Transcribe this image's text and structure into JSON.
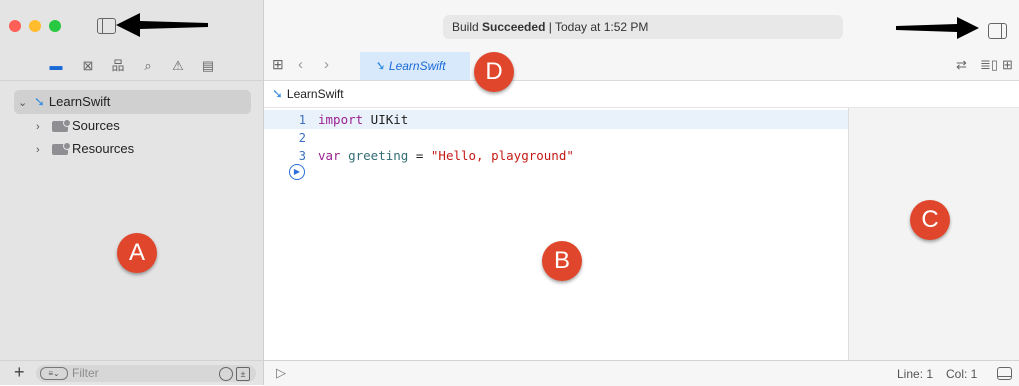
{
  "window": {
    "status_main": "Build",
    "status_bold": "Succeeded",
    "status_sep": "|",
    "status_time": "Today at 1:52 PM"
  },
  "navigator": {
    "tree": [
      {
        "label": "LearnSwift",
        "chevron": "⌄"
      },
      {
        "label": "Sources",
        "chevron": "›"
      },
      {
        "label": "Resources",
        "chevron": "›"
      }
    ],
    "filter_placeholder": "Filter",
    "add_symbol": "+"
  },
  "editor": {
    "tab_label": "LearnSwift",
    "breadcrumb": "LearnSwift",
    "lines": [
      {
        "num": "1",
        "kw": "import",
        "rest": " UIKit"
      },
      {
        "num": "2"
      },
      {
        "num": "3",
        "kw": "var",
        "id": " greeting",
        "op": " = ",
        "str": "\"Hello, playground\""
      }
    ],
    "status_line": "Line: 1",
    "status_col": "Col: 1"
  },
  "annotations": {
    "a": "A",
    "b": "B",
    "c": "C",
    "d": "D"
  },
  "colors": {
    "badge": "#e0462b",
    "tab_bg": "#d8e9fb",
    "sidebar_bg": "#e4e4e4"
  },
  "icons": [
    "folder-icon",
    "x-square-icon",
    "hierarchy-icon",
    "search-icon",
    "warning-icon",
    "list-icon",
    "grid-icon",
    "back-icon",
    "forward-icon",
    "swift-icon",
    "refresh-icon",
    "adjust-editor-icon",
    "add-editor-icon",
    "play-icon",
    "panel-toggle-icon",
    "clock-icon"
  ]
}
